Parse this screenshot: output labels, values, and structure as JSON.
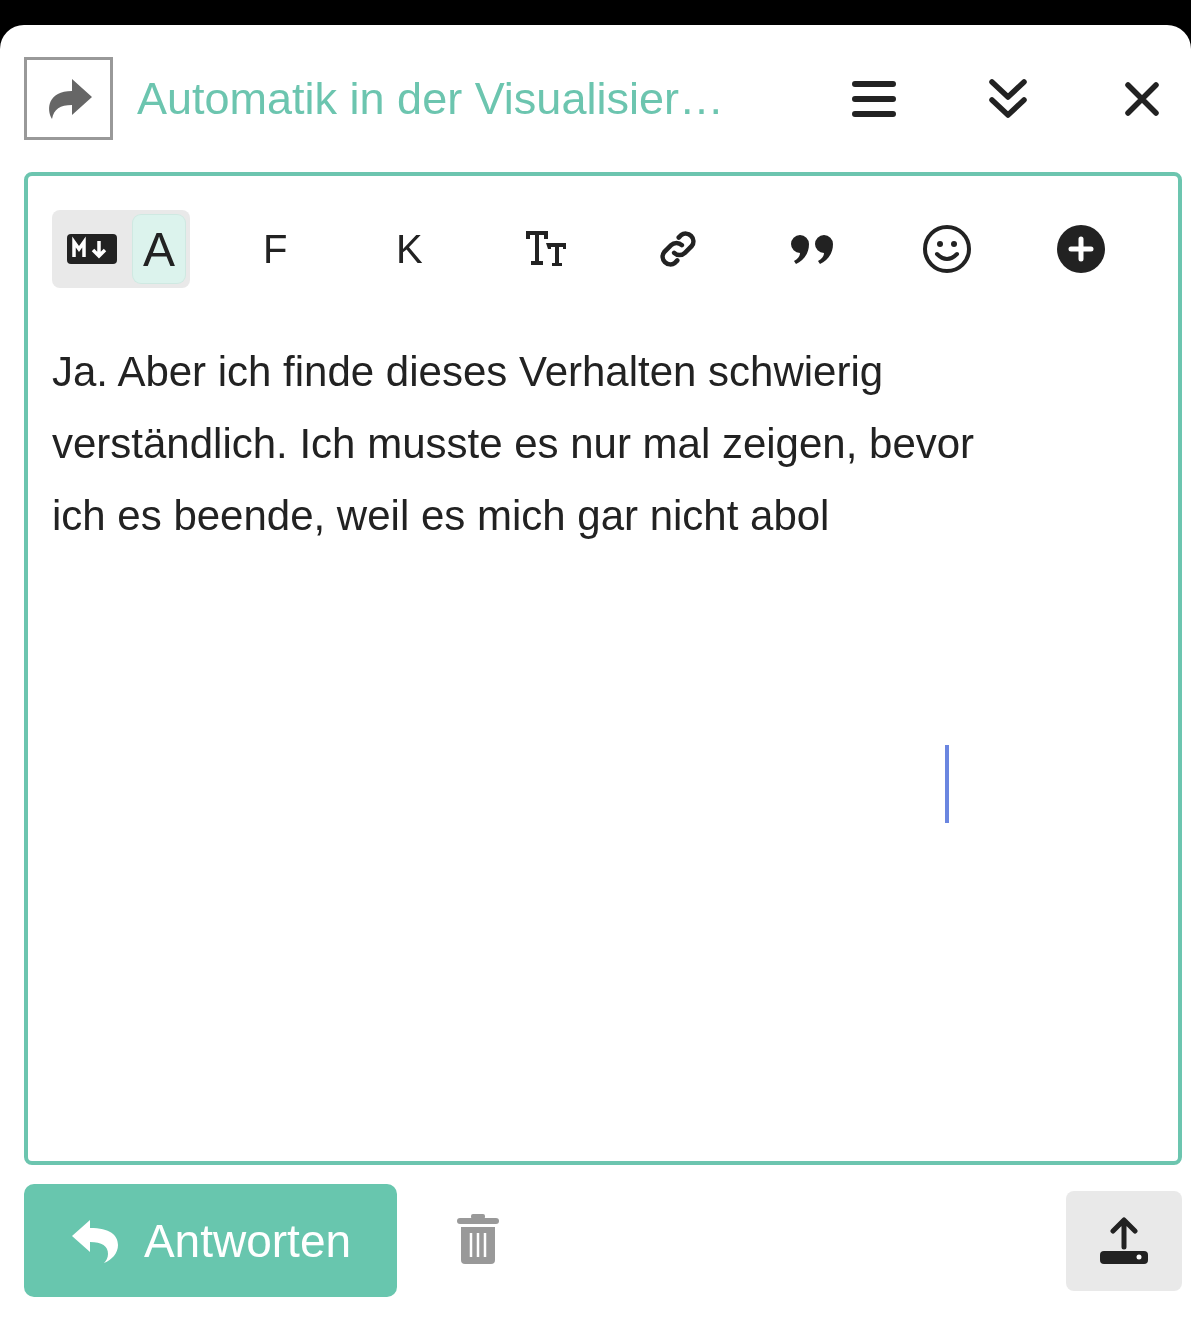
{
  "header": {
    "title": "Automatik in der Visualisier…"
  },
  "toolbar": {
    "mode_toggle": [
      {
        "kind": "markdown",
        "selected": false
      },
      {
        "kind": "rich",
        "label": "A",
        "selected": true
      }
    ],
    "buttons": [
      {
        "kind": "text",
        "label": "F"
      },
      {
        "kind": "text",
        "label": "K"
      },
      {
        "kind": "heading"
      },
      {
        "kind": "link"
      },
      {
        "kind": "quote"
      },
      {
        "kind": "emoji"
      },
      {
        "kind": "add"
      }
    ]
  },
  "editor": {
    "value": "Ja. Aber ich finde dieses Verhalten schwierig verständlich. Ich musste es nur mal zeigen, bevor ich es beende, weil es mich gar nicht abol"
  },
  "footer": {
    "reply_button": "Antworten"
  }
}
